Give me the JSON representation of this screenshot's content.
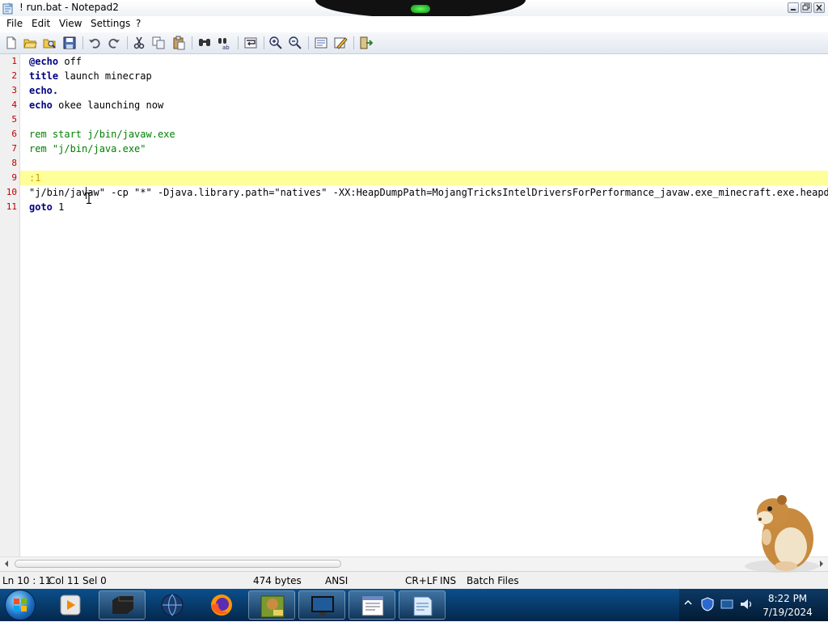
{
  "window": {
    "title": "! run.bat - Notepad2",
    "buttons": [
      "minimize",
      "restore",
      "close"
    ]
  },
  "menu": [
    "File",
    "Edit",
    "View",
    "Settings",
    "?"
  ],
  "toolbar_icons": [
    "new-file-icon",
    "open-folder-icon",
    "browse-icon",
    "save-icon",
    "undo-icon",
    "redo-icon",
    "cut-icon",
    "copy-icon",
    "paste-icon",
    "find-icon",
    "replace-icon",
    "word-wrap-icon",
    "zoom-in-icon",
    "zoom-out-icon",
    "scheme-icon",
    "customize-scheme-icon",
    "exit-icon"
  ],
  "editor": {
    "lines": [
      {
        "n": "1",
        "kw": "@echo",
        "rest": " off",
        "style": "kw"
      },
      {
        "n": "2",
        "kw": "title",
        "rest": " launch minecrap",
        "style": "kw"
      },
      {
        "n": "3",
        "kw": "echo.",
        "rest": "",
        "style": "kw"
      },
      {
        "n": "4",
        "kw": "echo",
        "rest": " okee launching now",
        "style": "kw"
      },
      {
        "n": "5",
        "kw": "",
        "rest": "",
        "style": "plain"
      },
      {
        "n": "6",
        "kw": "",
        "rest": "rem start j/bin/javaw.exe",
        "style": "cmt"
      },
      {
        "n": "7",
        "kw": "",
        "rest": "rem \"j/bin/java.exe\"",
        "style": "cmt"
      },
      {
        "n": "8",
        "kw": "",
        "rest": "",
        "style": "plain"
      },
      {
        "n": "9",
        "kw": "",
        "rest": ":1",
        "style": "lbl"
      },
      {
        "n": "10",
        "kw": "",
        "rest": "\"j/bin/javaw\" -cp \"*\" -Djava.library.path=\"natives\" -XX:HeapDumpPath=MojangTricksIntelDriversForPerformance_javaw.exe_minecraft.exe.heapdump n",
        "style": "plain"
      },
      {
        "n": "11",
        "kw": "goto",
        "rest": " 1",
        "style": "kw"
      }
    ],
    "highlight_line": 9,
    "caret": {
      "line": 10,
      "col": 11
    }
  },
  "status": {
    "position": "Ln 10 : 11",
    "column": "Col 11",
    "selection": "Sel 0",
    "size": "474 bytes",
    "encoding": "ANSI",
    "line_endings": "CR+LF",
    "mode": "INS",
    "scheme": "Batch Files"
  },
  "taskbar": {
    "items": [
      "media-player",
      "console",
      "network-globe",
      "firefox",
      "hamster-box",
      "monitor",
      "notepad-document",
      "notepad2"
    ],
    "clock": {
      "time": "8:22 PM",
      "date": "7/19/2024"
    }
  }
}
